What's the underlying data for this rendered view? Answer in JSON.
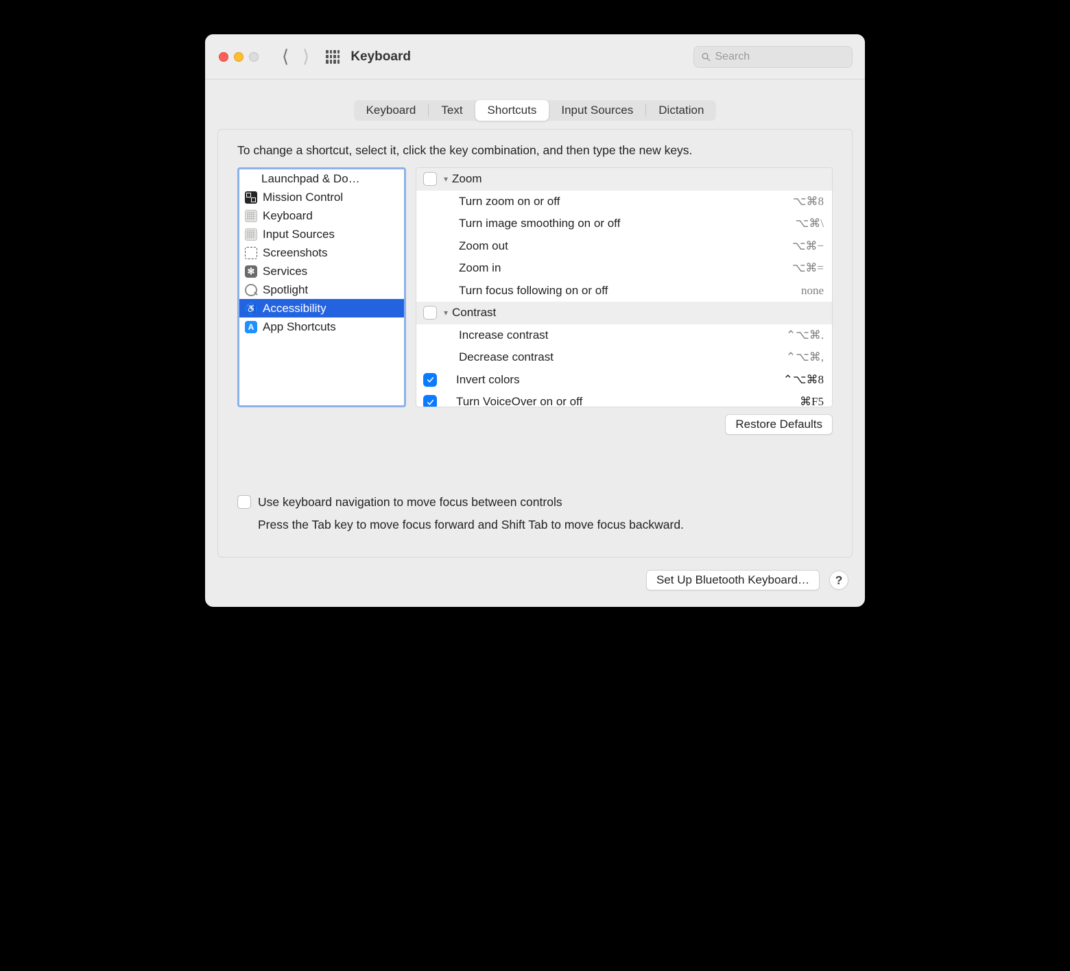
{
  "window": {
    "title": "Keyboard"
  },
  "search": {
    "placeholder": "Search"
  },
  "tabs": [
    "Keyboard",
    "Text",
    "Shortcuts",
    "Input Sources",
    "Dictation"
  ],
  "activeTab": "Shortcuts",
  "instructions": "To change a shortcut, select it, click the key combination, and then type the new keys.",
  "categories": [
    {
      "label": "Launchpad & Do…",
      "icon": "lp"
    },
    {
      "label": "Mission Control",
      "icon": "mc"
    },
    {
      "label": "Keyboard",
      "icon": "kb"
    },
    {
      "label": "Input Sources",
      "icon": "kb"
    },
    {
      "label": "Screenshots",
      "icon": "sc"
    },
    {
      "label": "Services",
      "icon": "sv"
    },
    {
      "label": "Spotlight",
      "icon": "sp"
    },
    {
      "label": "Accessibility",
      "icon": "ax"
    },
    {
      "label": "App Shortcuts",
      "icon": "as"
    }
  ],
  "selectedCategory": "Accessibility",
  "shortcuts": [
    {
      "type": "group",
      "checked": false,
      "label": "Zoom"
    },
    {
      "type": "item",
      "label": "Turn zoom on or off",
      "keys": "⌥⌘8"
    },
    {
      "type": "item",
      "label": "Turn image smoothing on or off",
      "keys": "⌥⌘\\"
    },
    {
      "type": "item",
      "label": "Zoom out",
      "keys": "⌥⌘−"
    },
    {
      "type": "item",
      "label": "Zoom in",
      "keys": "⌥⌘="
    },
    {
      "type": "item",
      "label": "Turn focus following on or off",
      "keys": "none"
    },
    {
      "type": "group",
      "checked": false,
      "label": "Contrast"
    },
    {
      "type": "item",
      "label": "Increase contrast",
      "keys": "⌃⌥⌘."
    },
    {
      "type": "item",
      "label": "Decrease contrast",
      "keys": "⌃⌥⌘,"
    },
    {
      "type": "top",
      "checked": true,
      "label": "Invert colors",
      "keys": "⌃⌥⌘8"
    },
    {
      "type": "top",
      "checked": true,
      "label": "Turn VoiceOver on or off",
      "keys": "⌘F5"
    }
  ],
  "restoreDefaults": "Restore Defaults",
  "kbdNav": {
    "label": "Use keyboard navigation to move focus between controls",
    "hint": "Press the Tab key to move focus forward and Shift Tab to move focus backward."
  },
  "footer": {
    "bluetooth": "Set Up Bluetooth Keyboard…",
    "help": "?"
  }
}
